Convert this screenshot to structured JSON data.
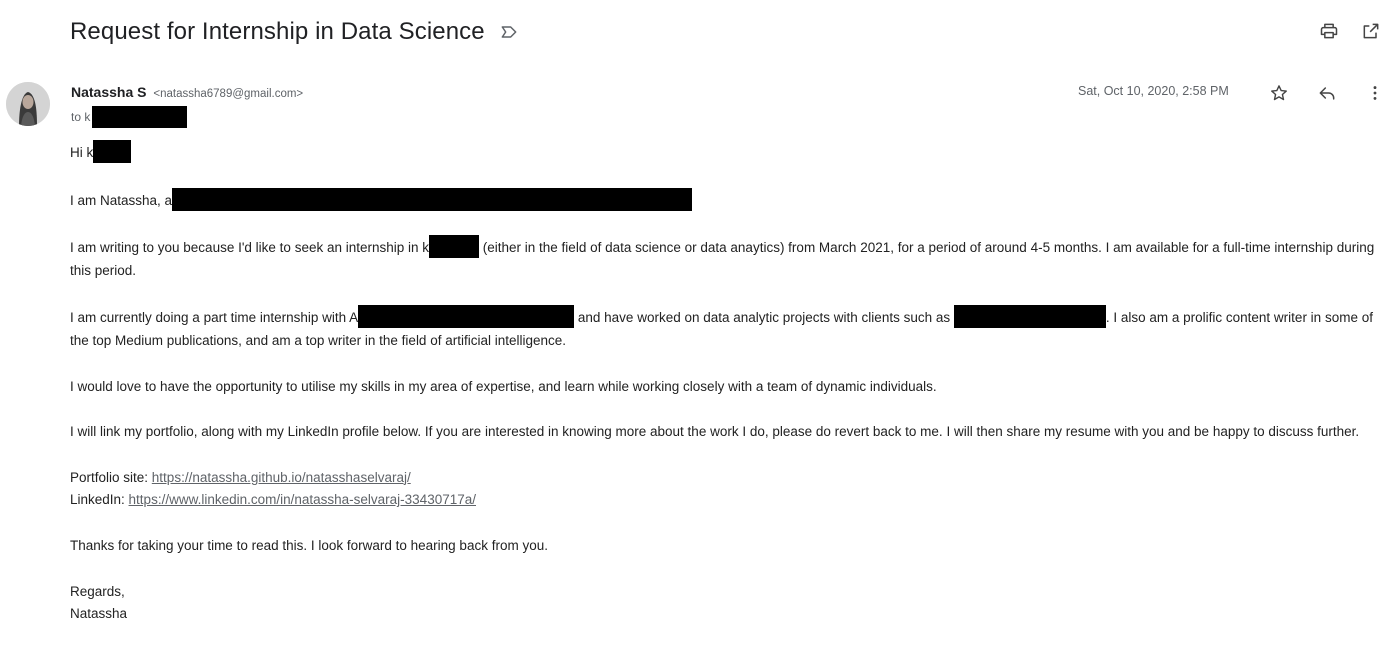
{
  "email": {
    "subject": "Request for Internship in Data Science",
    "sender_name": "Natassha S",
    "sender_email": "<natassha6789@gmail.com>",
    "to_prefix": "to k",
    "date": "Sat, Oct 10, 2020, 2:58 PM",
    "body": {
      "greeting": "Hi k",
      "intro": "I am Natassha, a",
      "p2_a": "I am writing to you because I'd like to seek an internship in k",
      "p2_b": " (either in the field of data science or data anaytics) from March 2021, for a period of around 4-5 months. I am available for a full-time internship during this period.",
      "p3_a": "I am currently doing a part time internship with A",
      "p3_b": " and have worked on data analytic projects with clients such as ",
      "p3_c": ". I also am a prolific content writer in some of the top Medium publications, and am a top writer in the field of artificial intelligence.",
      "p4": "I would love to have the opportunity to utilise my skills in my area of expertise, and learn while working closely with a team of dynamic individuals.",
      "p5": "I will link my portfolio, along with my LinkedIn profile below. If you are interested in knowing more about the work I do, please do revert back to me. I will then share my resume with you and be happy to discuss further.",
      "portfolio_label": "Portfolio site: ",
      "portfolio_url": "https://natassha.github.io/natasshaselvaraj/",
      "linkedin_label": "LinkedIn: ",
      "linkedin_url": "https://www.linkedin.com/in/natassha-selvaraj-33430717a/",
      "thanks": "Thanks for taking your time to read this. I look forward to hearing back from you.",
      "closing": "Regards,",
      "signature": "Natassha"
    }
  },
  "icons": {
    "label": "label-outline-icon",
    "print": "print-icon",
    "open_new_window": "open-in-new-icon",
    "star": "star-outline-icon",
    "reply": "reply-icon",
    "more": "more-vert-icon",
    "avatar": "avatar"
  },
  "colors": {
    "text": "#222222",
    "muted": "#5f6368",
    "redaction": "#000000"
  }
}
